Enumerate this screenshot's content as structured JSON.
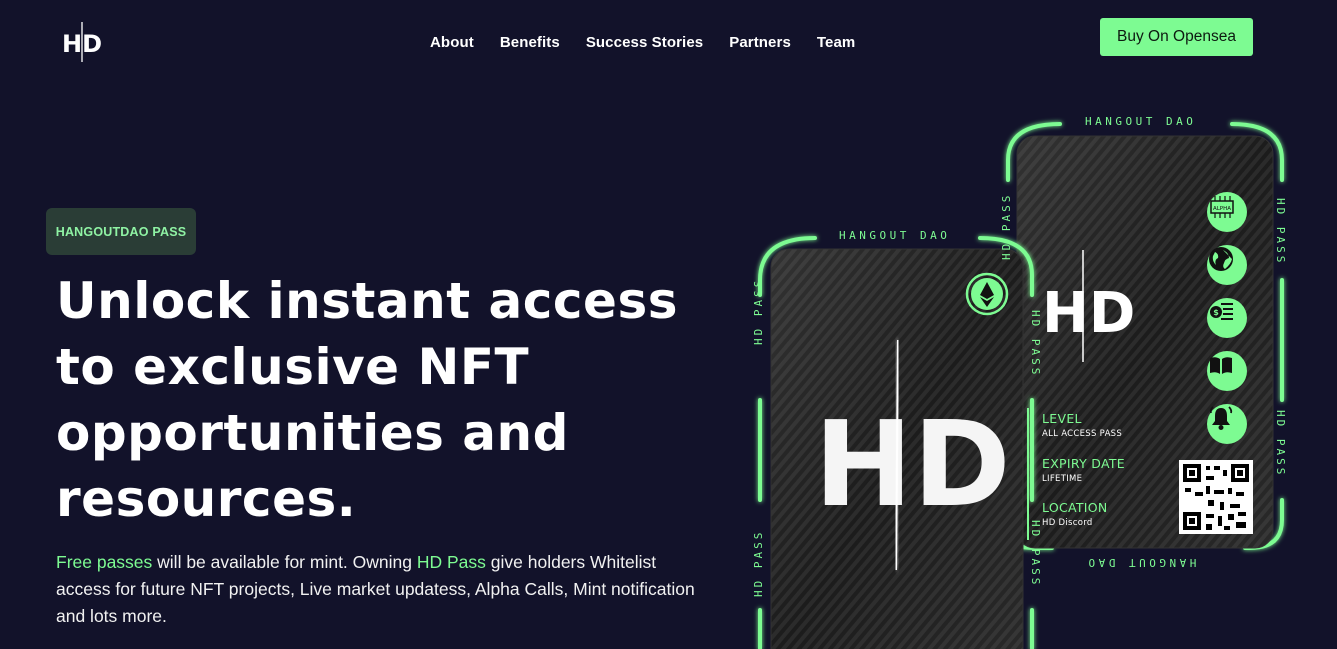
{
  "header": {
    "logo_text": "HD",
    "nav": [
      "About",
      "Benefits",
      "Success Stories",
      "Partners",
      "Team"
    ],
    "cta_label": "Buy On Opensea"
  },
  "hero": {
    "badge": "HANGOUTDAO PASS",
    "headline_lines": [
      "Unlock instant access",
      "to exclusive NFT",
      "opportunities and",
      "resources."
    ],
    "desc": {
      "hl1": "Free passes",
      "t1": " will be available for mint. Owning ",
      "hl2": "HD Pass",
      "t2": " give holders Whitelist access for future NFT projects, Live market updatess, Alpha Calls, Mint notification and lots more."
    }
  },
  "cards": {
    "front": {
      "top_label": "HANGOUT DAO",
      "side_label": "HD PASS",
      "logo": "HD",
      "icon": "ethereum-icon"
    },
    "back": {
      "top_label": "HANGOUT DAO",
      "bottom_label": "HANGOUT DAO",
      "side_label": "HD PASS",
      "logo": "HD",
      "fields": [
        {
          "label": "LEVEL",
          "value": "ALL ACCESS PASS"
        },
        {
          "label": "EXPIRY DATE",
          "value": "LIFETIME"
        },
        {
          "label": "LOCATION",
          "value": "HD Discord"
        }
      ],
      "icons": [
        "alpha-chip-icon",
        "globe-icon",
        "coin-list-icon",
        "book-icon",
        "bell-icon"
      ],
      "alpha_text": "ALPHA"
    }
  },
  "colors": {
    "background": "#12122a",
    "accent": "#7dfb92",
    "badge_bg": "#2a3d36"
  }
}
